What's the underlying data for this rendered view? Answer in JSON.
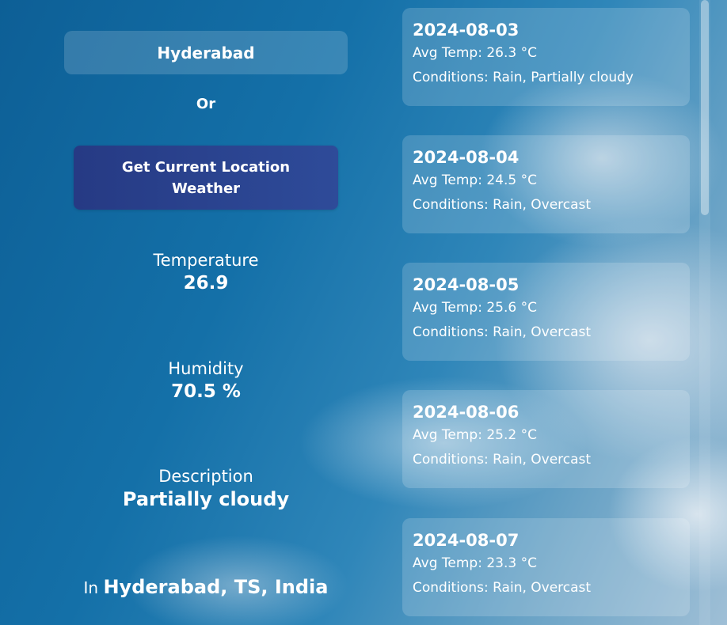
{
  "search": {
    "city_value": "Hyderabad",
    "or_text": "Or",
    "location_button_label": "Get Current Location Weather"
  },
  "current": {
    "temperature_label": "Temperature",
    "temperature_value": "26.9",
    "humidity_label": "Humidity",
    "humidity_value": "70.5 %",
    "description_label": "Description",
    "description_value": "Partially cloudy",
    "location_prefix": "In",
    "location_name": "Hyderabad, TS, India"
  },
  "forecast": [
    {
      "date": "2024-08-03",
      "avg_temp": "Avg Temp: 26.3 °C",
      "conditions": "Conditions: Rain, Partially cloudy"
    },
    {
      "date": "2024-08-04",
      "avg_temp": "Avg Temp: 24.5 °C",
      "conditions": "Conditions: Rain, Overcast"
    },
    {
      "date": "2024-08-05",
      "avg_temp": "Avg Temp: 25.6 °C",
      "conditions": "Conditions: Rain, Overcast"
    },
    {
      "date": "2024-08-06",
      "avg_temp": "Avg Temp: 25.2 °C",
      "conditions": "Conditions: Rain, Overcast"
    },
    {
      "date": "2024-08-07",
      "avg_temp": "Avg Temp: 23.3 °C",
      "conditions": "Conditions: Rain, Overcast"
    }
  ],
  "colors": {
    "button": "#2e4b99",
    "text": "#ffffff"
  }
}
